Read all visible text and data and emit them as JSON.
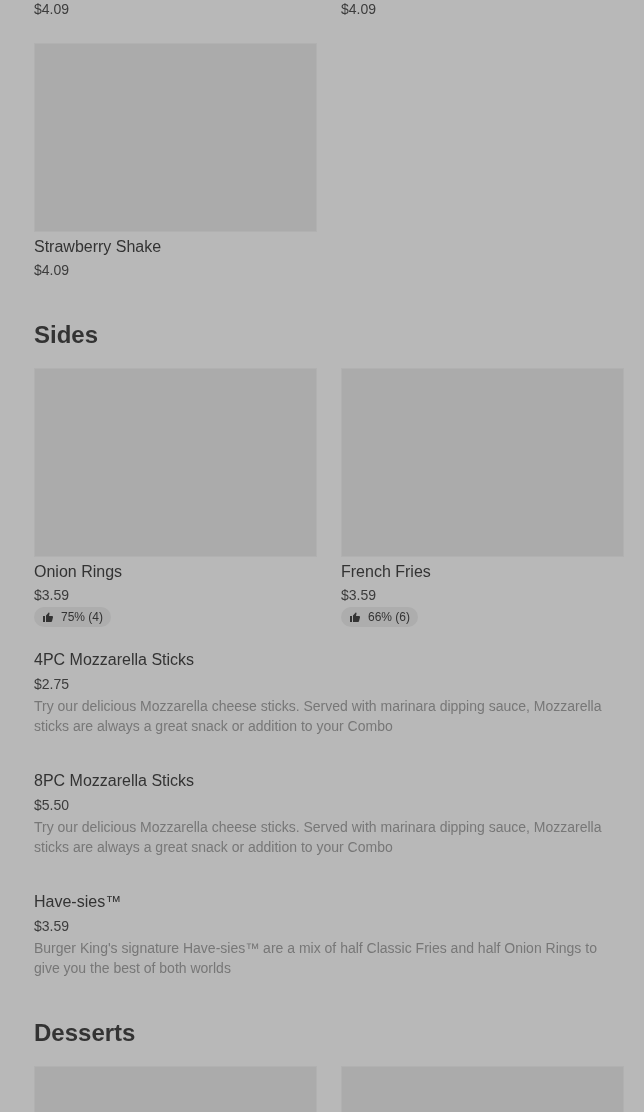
{
  "top_prices": [
    "$4.09",
    "$4.09"
  ],
  "sections": [
    {
      "cards": [
        {
          "kind": "product",
          "name": "Strawberry Shake",
          "price": "$4.09"
        }
      ]
    },
    {
      "title": "Sides",
      "cards": [
        {
          "kind": "product",
          "name": "Onion Rings",
          "price": "$3.59",
          "rating": "75% (4)"
        },
        {
          "kind": "product",
          "name": "French Fries",
          "price": "$3.59",
          "rating": "66% (6)"
        }
      ],
      "list": [
        {
          "name": "4PC Mozzarella Sticks",
          "price": "$2.75",
          "description": "Try our delicious Mozzarella cheese sticks. Served with marinara dipping sauce, Mozzarella sticks are always a great snack or addition to your Combo"
        },
        {
          "name": "8PC Mozzarella Sticks",
          "price": "$5.50",
          "description": "Try our delicious Mozzarella cheese sticks. Served with marinara dipping sauce, Mozzarella sticks are always a great snack or addition to your Combo"
        },
        {
          "name": "Have-sies™",
          "price": "$3.59",
          "description": "Burger King's signature Have-sies™ are a mix of half Classic Fries and half Onion Rings to give you the best of both worlds"
        }
      ]
    },
    {
      "title": "Desserts",
      "cards": [
        {
          "kind": "image_only"
        },
        {
          "kind": "image_only"
        }
      ]
    }
  ]
}
